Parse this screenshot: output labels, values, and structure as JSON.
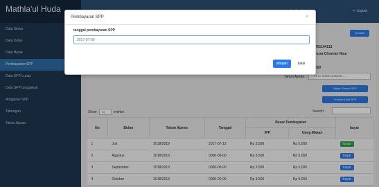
{
  "brand": "Mathla'ul Huda",
  "sidebar": {
    "items": [
      {
        "label": "Data Siswa"
      },
      {
        "label": "Data Kelas"
      },
      {
        "label": "Data Bayar"
      },
      {
        "label": "Pembayaran SPP"
      },
      {
        "label": "Data SPP Lunas"
      },
      {
        "label": "Data SPP tunggakan"
      },
      {
        "label": "Anggaran SPP"
      },
      {
        "label": "Tabungan"
      },
      {
        "label": "Tahun Ajaran"
      }
    ]
  },
  "topbar": {
    "user": "koshnala",
    "logout": "Logout"
  },
  "content": {
    "kembali": "Kembali",
    "info_nis": "701144112",
    "info_nama": "nuza Choerun Nisa",
    "info_bayar": "000",
    "tahun_label": "Tahun Ajaran :",
    "tahun_select": "-- PILIH TAHUN AJARAN --",
    "btn_all_1": "Bayar Semua SPP",
    "btn_all_2": "Tambah Data SPP",
    "show_label": "Show",
    "show_value": "10",
    "entries_label": "entries",
    "search_label": "Search:"
  },
  "table": {
    "headers": [
      "No",
      "Bulan",
      "Tahun Ajaran",
      "Tanggal",
      "Besar Pembayaran",
      "bayar"
    ],
    "subheaders": [
      "IPP",
      "Uang Makan"
    ],
    "rows": [
      {
        "no": "1",
        "bulan": "Juli",
        "tahun": "2018/2019",
        "tanggal": "2017-07-12",
        "ipp": "Rp 3.500",
        "makan": "Rp 5.000",
        "bayar": "lunas"
      },
      {
        "no": "2",
        "bulan": "Agustus",
        "tahun": "2018/2019",
        "tanggal": "0000-00-00",
        "ipp": "Rp 3.500",
        "makan": "Rp 5.000",
        "bayar": "bayar"
      },
      {
        "no": "3",
        "bulan": "September",
        "tahun": "2018/2019",
        "tanggal": "0000-00-00",
        "ipp": "Rp 3.500",
        "makan": "Rp 5.000",
        "bayar": "bayar"
      },
      {
        "no": "4",
        "bulan": "Oktober",
        "tahun": "2018/2019",
        "tanggal": "0000-00-00",
        "ipp": "Rp 3.500",
        "makan": "Rp 5.000",
        "bayar": "bayar"
      }
    ]
  },
  "modal": {
    "title": "Pembayaran SPP",
    "close": "×",
    "field_label": "tanggal pembayaran SPP",
    "field_value": "2017-07-09",
    "save": "simpan",
    "cancel": "batal"
  },
  "colors": {
    "sidebar": "#1f3650",
    "topbar": "#2b4f73",
    "active": "#2c6ea8",
    "primary": "#2c7be5",
    "success": "#2f9e4a"
  }
}
